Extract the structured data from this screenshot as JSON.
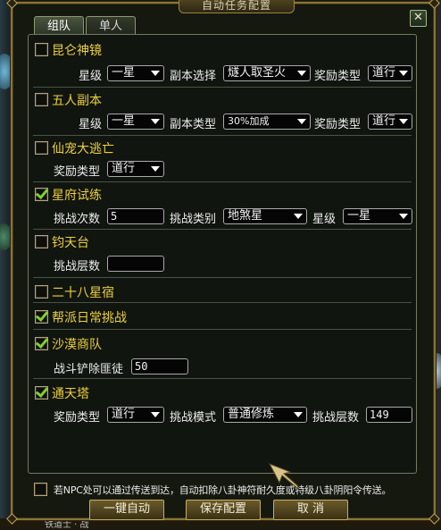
{
  "window": {
    "title": "自动任务配置",
    "close_glyph": "✕"
  },
  "tabs": [
    {
      "label": "组队",
      "active": true
    },
    {
      "label": "单人",
      "active": false
    }
  ],
  "sections": {
    "kunlun": {
      "title": "昆仑神镜",
      "checked": false,
      "star_label": "星级",
      "star_value": "一星",
      "copy_label": "副本选择",
      "copy_value": "燧人取圣火",
      "reward_label": "奖励类型",
      "reward_value": "道行"
    },
    "wuren": {
      "title": "五人副本",
      "checked": false,
      "star_label": "星级",
      "star_value": "一星",
      "copy_label": "副本类型",
      "copy_value": "30%加成",
      "reward_label": "奖励类型",
      "reward_value": "道行"
    },
    "xianchong": {
      "title": "仙宠大逃亡",
      "checked": false,
      "reward_label": "奖励类型",
      "reward_value": "道行"
    },
    "xingfu": {
      "title": "星府试练",
      "checked": true,
      "count_label": "挑战次数",
      "count_value": "5",
      "category_label": "挑战类别",
      "category_value": "地煞星",
      "star_label": "星级",
      "star_value": "一星"
    },
    "juntian": {
      "title": "钧天台",
      "checked": false,
      "floor_label": "挑战层数",
      "floor_value": ""
    },
    "ershiba": {
      "title": "二十八星宿",
      "checked": false
    },
    "bangpai": {
      "title": "帮派日常挑战",
      "checked": true
    },
    "shamo": {
      "title": "沙漠商队",
      "checked": true,
      "bandit_label": "战斗铲除匪徒",
      "bandit_value": "50"
    },
    "tongtian": {
      "title": "通天塔",
      "checked": true,
      "reward_label": "奖励类型",
      "reward_value": "道行",
      "mode_label": "挑战模式",
      "mode_value": "普通修炼",
      "floor_label": "挑战层数",
      "floor_value": "149"
    }
  },
  "footer": {
    "note_checked": false,
    "note": "若NPC处可以通过传送到达，自动扣除八卦神符耐久度或特级八卦阴阳令传送。",
    "btn_auto": "一键自动",
    "btn_save": "保存配置",
    "btn_cancel": "取 消"
  },
  "background": {
    "bottom_text": "铁道士 · 战"
  },
  "colors": {
    "section_title": "#ecd03c",
    "frame_gold": "#8a7436",
    "check_green": "#7fd030"
  }
}
